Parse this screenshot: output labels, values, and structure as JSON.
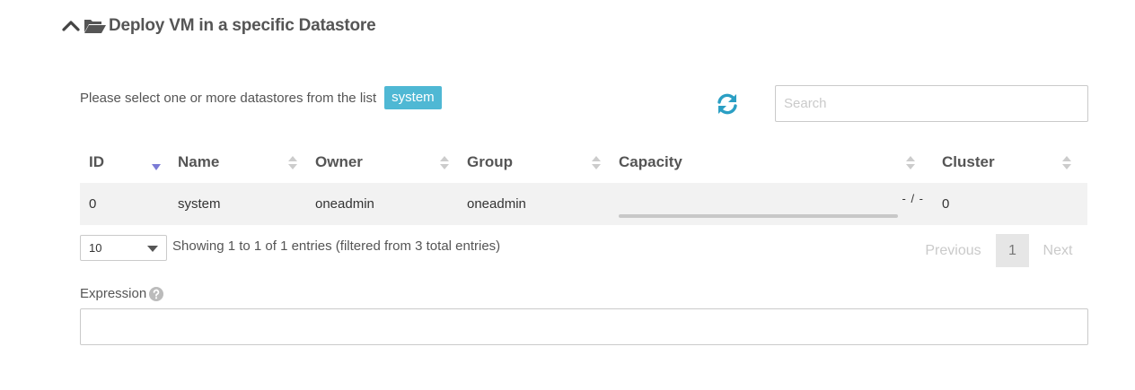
{
  "section": {
    "title": "Deploy VM in a specific Datastore",
    "icons": [
      "chevron-up-icon",
      "folder-open-icon"
    ]
  },
  "selection": {
    "prompt": "Please select one or more datastores from the list",
    "selected_badge": "system"
  },
  "toolbar": {
    "refresh_icon": "refresh-icon",
    "search_placeholder": "Search"
  },
  "table": {
    "columns": [
      {
        "label": "ID",
        "sort": "desc"
      },
      {
        "label": "Name",
        "sort": "none"
      },
      {
        "label": "Owner",
        "sort": "none"
      },
      {
        "label": "Group",
        "sort": "none"
      },
      {
        "label": "Capacity",
        "sort": "none"
      },
      {
        "label": "Cluster",
        "sort": "none"
      }
    ],
    "rows": [
      {
        "id": "0",
        "name": "system",
        "owner": "oneadmin",
        "group": "oneadmin",
        "capacity": "- / -",
        "capacity_fraction": 0,
        "cluster": "0"
      }
    ]
  },
  "footer": {
    "page_length": "10",
    "info": "Showing 1 to 1 of 1 entries (filtered from 3 total entries)",
    "previous_label": "Previous",
    "current_page": "1",
    "next_label": "Next"
  },
  "expression": {
    "label": "Expression",
    "help_icon": "question-circle-icon",
    "value": ""
  },
  "colors": {
    "accent": "#4fb8d4",
    "refresh": "#2b9fc4",
    "sort_active": "#7b7bd6",
    "sort_inactive": "#cccccc",
    "row_bg": "#f2f2f2"
  }
}
